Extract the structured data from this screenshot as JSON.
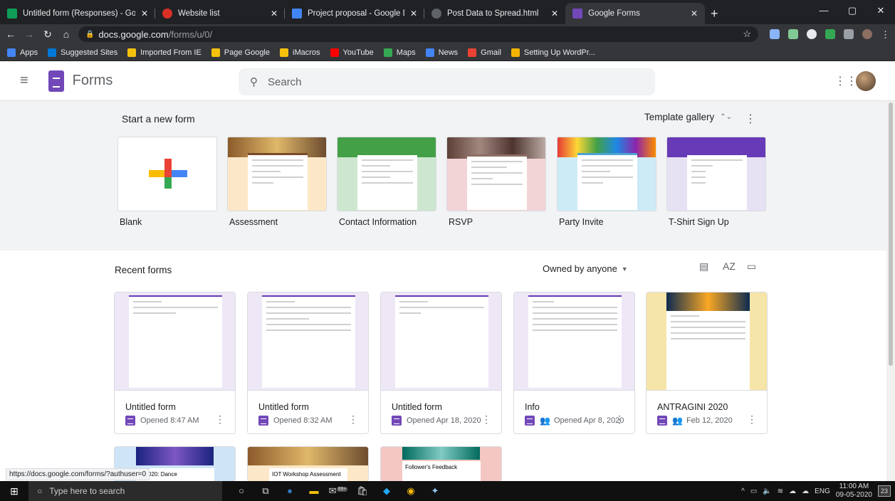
{
  "browser": {
    "tabs": [
      {
        "title": "Untitled form (Responses) - Goo",
        "fav_color": "#0f9d58"
      },
      {
        "title": "Website list",
        "fav_color": "#d93025"
      },
      {
        "title": "Project proposal - Google Docs",
        "fav_color": "#4285f4"
      },
      {
        "title": "Post Data to Spread.html",
        "fav_color": "#5f6368"
      },
      {
        "title": "Google Forms",
        "fav_color": "#7248b9"
      }
    ],
    "url_host": "docs.google.com",
    "url_path": "/forms/u/0/",
    "bookmarks": [
      {
        "label": "Apps",
        "color": "#4285f4"
      },
      {
        "label": "Suggested Sites",
        "color": "#0078d7"
      },
      {
        "label": "Imported From IE",
        "color": "#f4c20d"
      },
      {
        "label": "Page Google",
        "color": "#f4c20d"
      },
      {
        "label": "iMacros",
        "color": "#f4c20d"
      },
      {
        "label": "YouTube",
        "color": "#ff0000"
      },
      {
        "label": "Maps",
        "color": "#34a853"
      },
      {
        "label": "News",
        "color": "#4285f4"
      },
      {
        "label": "Gmail",
        "color": "#ea4335"
      },
      {
        "label": "Setting Up WordPr...",
        "color": "#f4b400"
      }
    ]
  },
  "header": {
    "app_name": "Forms",
    "search_placeholder": "Search"
  },
  "new_form": {
    "title": "Start a new form",
    "template_gallery": "Template gallery",
    "templates": [
      {
        "label": "Blank",
        "bg": "#ffffff",
        "accent": "#ffffff"
      },
      {
        "label": "Assessment",
        "bg": "#fce8c8",
        "accent": "#7a4a2a"
      },
      {
        "label": "Contact Information",
        "bg": "#cde7cf",
        "accent": "#43a047"
      },
      {
        "label": "RSVP",
        "bg": "#f3d4d6",
        "accent": "#8d6e63"
      },
      {
        "label": "Party Invite",
        "bg": "#cdebf7",
        "accent": "#4fa3d1"
      },
      {
        "label": "T-Shirt Sign Up",
        "bg": "#e7e1f4",
        "accent": "#673ab7"
      }
    ]
  },
  "recent": {
    "title": "Recent forms",
    "owned_filter": "Owned by anyone",
    "cards": [
      {
        "name": "Untitled form",
        "meta": "Opened 8:47 AM",
        "shared": false,
        "preview_bg": "#ede7f6"
      },
      {
        "name": "Untitled form",
        "meta": "Opened 8:32 AM",
        "shared": false,
        "preview_bg": "#ede7f6"
      },
      {
        "name": "Untitled form",
        "meta": "Opened Apr 18, 2020",
        "shared": false,
        "preview_bg": "#ede7f6"
      },
      {
        "name": "Info",
        "meta": "Opened Apr 8, 2020",
        "shared": true,
        "preview_bg": "#ede7f6"
      },
      {
        "name": "ANTRAGINI 2020",
        "meta": "Feb 12, 2020",
        "shared": true,
        "preview_bg": "#f6e5a8"
      }
    ],
    "partial_cards": [
      {
        "preview_text": "ni 2020: Dance",
        "bg": "#cfe4f7"
      },
      {
        "preview_text": "IOT Workshop Assessment",
        "bg": "#fce8c8"
      },
      {
        "preview_text": "Follower's Feedback",
        "bg": "#f4c7c3"
      }
    ]
  },
  "status_url": "https://docs.google.com/forms/?authuser=0",
  "taskbar": {
    "search_placeholder": "Type here to search",
    "lang": "ENG",
    "time": "11:00 AM",
    "date": "09-05-2020",
    "notifications": "23",
    "badge": "99+"
  }
}
